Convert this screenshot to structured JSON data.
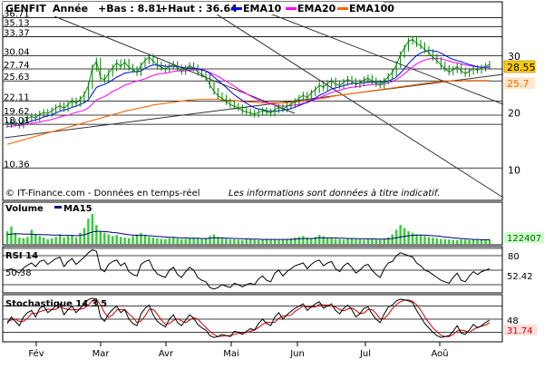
{
  "header": {
    "symbol": "GENFIT",
    "period": "Année",
    "low_label": "+Bas : 8.81",
    "high_label": "+Haut : 36.64",
    "legend": [
      {
        "label": "EMA10",
        "color": "#0000ff"
      },
      {
        "label": "EMA20",
        "color": "#ff00ff"
      },
      {
        "label": "EMA100",
        "color": "#ff6600"
      }
    ]
  },
  "footer": {
    "copyright": "© IT-Finance.com - Données en temps-réel",
    "disclaimer": "Les informations sont données à titre indicatif."
  },
  "colors": {
    "price": "#008000",
    "ema10": "#0000ff",
    "ema20": "#ff00ff",
    "ema100": "#ff6600",
    "volume": "#33cc33",
    "ma15": "#000080",
    "trend": "#333333",
    "last_price_bg": "#ffcc00",
    "last_ema_bg": "#ffe8cc"
  },
  "chart_data": [
    {
      "type": "line",
      "name": "price",
      "months": [
        "Fév",
        "Mar",
        "Avr",
        "Mai",
        "Jun",
        "Jul",
        "Aoû"
      ],
      "left_ticks": [
        "36.71",
        "35.13",
        "33.37",
        "30.04",
        "27.74",
        "25.63",
        "22.11",
        "19.62",
        "18.01",
        "10.36"
      ],
      "right_ticks": [
        "30",
        "20",
        "10"
      ],
      "last_price": "28.55",
      "last_ema": "25.7",
      "ylim": [
        8.81,
        36.64
      ],
      "close": [
        18.0,
        18.4,
        18.2,
        17.9,
        18.5,
        19.0,
        19.4,
        19.1,
        19.8,
        20.1,
        19.9,
        20.4,
        20.9,
        21.3,
        20.8,
        21.5,
        22.1,
        21.7,
        22.4,
        23.2,
        24.8,
        27.9,
        29.1,
        26.2,
        25.8,
        27.0,
        27.9,
        28.8,
        28.2,
        28.9,
        28.0,
        27.6,
        27.1,
        28.3,
        29.2,
        29.8,
        29.1,
        28.4,
        28.0,
        27.7,
        28.2,
        28.5,
        27.9,
        27.3,
        27.8,
        28.3,
        27.9,
        27.2,
        26.8,
        26.2,
        24.9,
        23.8,
        23.0,
        22.6,
        22.0,
        21.5,
        21.2,
        20.9,
        20.4,
        20.2,
        20.0,
        19.8,
        20.1,
        20.4,
        20.2,
        20.0,
        20.6,
        21.0,
        20.7,
        21.2,
        21.5,
        22.0,
        22.6,
        23.1,
        22.7,
        23.5,
        24.1,
        24.9,
        24.5,
        25.2,
        25.6,
        25.1,
        24.8,
        25.4,
        25.9,
        25.5,
        25.0,
        25.3,
        25.8,
        26.1,
        25.6,
        25.2,
        24.9,
        25.6,
        26.4,
        27.1,
        28.5,
        30.2,
        31.4,
        32.6,
        32.9,
        32.2,
        31.8,
        31.1,
        30.6,
        29.8,
        29.2,
        28.4,
        27.8,
        27.2,
        27.6,
        28.1,
        27.4,
        26.9,
        27.3,
        27.8,
        27.5,
        27.9,
        28.2,
        28.55
      ],
      "ema10": [
        18.0,
        18.1,
        18.1,
        18.1,
        18.2,
        18.3,
        18.6,
        18.8,
        19.0,
        19.3,
        19.5,
        19.7,
        20.0,
        20.3,
        20.5,
        20.7,
        21.0,
        21.2,
        21.5,
        21.8,
        22.3,
        23.4,
        24.5,
        24.8,
        25.0,
        25.4,
        25.8,
        26.3,
        26.6,
        27.0,
        27.1,
        27.3,
        27.2,
        27.4,
        27.8,
        28.2,
        28.4,
        28.4,
        28.3,
        28.2,
        28.2,
        28.2,
        28.1,
        28.0,
        27.9,
        27.9,
        27.9,
        27.8,
        27.6,
        27.4,
        26.9,
        26.3,
        25.7,
        25.1,
        24.5,
        23.8,
        23.2,
        22.7,
        22.2,
        21.7,
        21.3,
        20.9,
        20.7,
        20.6,
        20.4,
        20.3,
        20.3,
        20.4,
        20.5,
        20.6,
        20.8,
        21.0,
        21.3,
        21.6,
        21.9,
        22.2,
        22.6,
        23.1,
        23.4,
        23.8,
        24.2,
        24.4,
        24.6,
        24.8,
        25.0,
        25.2,
        25.2,
        25.2,
        25.3,
        25.4,
        25.4,
        25.4,
        25.4,
        25.4,
        25.6,
        25.9,
        26.3,
        27.0,
        27.8,
        28.7,
        29.4,
        30.1,
        30.5,
        30.8,
        31.0,
        30.9,
        30.8,
        30.5,
        30.1,
        29.7,
        29.4,
        29.2,
        29.0,
        28.7,
        28.5,
        28.3,
        28.1,
        28.0,
        28.0,
        28.1
      ],
      "ema20": [
        17.6,
        17.7,
        17.8,
        17.8,
        17.9,
        18.0,
        18.2,
        18.3,
        18.4,
        18.6,
        18.7,
        18.9,
        19.1,
        19.3,
        19.5,
        19.6,
        19.9,
        20.1,
        20.3,
        20.5,
        20.9,
        21.6,
        22.3,
        22.6,
        22.9,
        23.3,
        23.8,
        24.1,
        24.5,
        24.9,
        25.1,
        25.4,
        25.6,
        25.8,
        26.0,
        26.3,
        26.6,
        26.8,
        26.9,
        27.0,
        27.1,
        27.3,
        27.4,
        27.4,
        27.4,
        27.5,
        27.6,
        27.6,
        27.5,
        27.4,
        27.1,
        26.8,
        26.4,
        26.0,
        25.6,
        25.1,
        24.7,
        24.2,
        23.8,
        23.4,
        23.0,
        22.6,
        22.3,
        22.0,
        21.8,
        21.6,
        21.4,
        21.3,
        21.2,
        21.2,
        21.3,
        21.4,
        21.5,
        21.7,
        21.8,
        22.1,
        22.4,
        22.7,
        23.0,
        23.3,
        23.6,
        23.8,
        24.0,
        24.2,
        24.4,
        24.5,
        24.6,
        24.7,
        24.8,
        24.9,
        25.0,
        25.0,
        25.0,
        25.1,
        25.3,
        25.5,
        25.9,
        26.3,
        26.9,
        27.5,
        28.1,
        28.6,
        29.0,
        29.3,
        29.5,
        29.6,
        29.6,
        29.5,
        29.3,
        29.1,
        28.9,
        28.8,
        28.6,
        28.4,
        28.3,
        28.2,
        28.1,
        28.0,
        28.0,
        28.0
      ],
      "ema100": [
        14.5,
        14.7,
        14.9,
        15.1,
        15.3,
        15.5,
        15.7,
        15.9,
        16.1,
        16.3,
        16.5,
        16.7,
        16.9,
        17.1,
        17.3,
        17.5,
        17.7,
        17.9,
        18.1,
        18.3,
        18.5,
        18.7,
        18.9,
        19.1,
        19.3,
        19.5,
        19.7,
        19.9,
        20.1,
        20.3,
        20.5,
        20.6,
        20.8,
        20.9,
        21.1,
        21.2,
        21.4,
        21.5,
        21.6,
        21.7,
        21.8,
        21.9,
        22.0,
        22.1,
        22.2,
        22.3,
        22.3,
        22.4,
        22.4,
        22.4,
        22.4,
        22.4,
        22.4,
        22.3,
        22.3,
        22.2,
        22.2,
        22.1,
        22.0,
        22.0,
        21.9,
        21.9,
        21.8,
        21.8,
        21.8,
        21.8,
        21.8,
        21.8,
        21.8,
        21.8,
        21.9,
        21.9,
        22.0,
        22.1,
        22.2,
        22.3,
        22.4,
        22.5,
        22.6,
        22.7,
        22.9,
        23.0,
        23.1,
        23.2,
        23.3,
        23.4,
        23.5,
        23.6,
        23.7,
        23.8,
        23.9,
        24.0,
        24.1,
        24.2,
        24.3,
        24.4,
        24.5,
        24.6,
        24.7,
        24.8,
        24.9,
        25.0,
        25.1,
        25.2,
        25.3,
        25.4,
        25.4,
        25.5,
        25.5,
        25.6,
        25.6,
        25.6,
        25.6,
        25.7,
        25.7,
        25.7,
        25.7,
        25.7,
        25.7,
        25.7
      ]
    },
    {
      "type": "bar",
      "name": "volume",
      "title": "Volume",
      "legend": "MA15",
      "last_value": "122407",
      "values": [
        40,
        55,
        35,
        20,
        18,
        22,
        45,
        30,
        25,
        20,
        15,
        18,
        22,
        30,
        20,
        25,
        28,
        20,
        35,
        50,
        80,
        95,
        60,
        40,
        35,
        30,
        25,
        28,
        22,
        20,
        18,
        25,
        30,
        35,
        28,
        22,
        20,
        18,
        16,
        15,
        18,
        20,
        17,
        15,
        16,
        18,
        20,
        17,
        15,
        18,
        25,
        30,
        22,
        18,
        16,
        15,
        14,
        13,
        12,
        14,
        15,
        13,
        12,
        14,
        16,
        15,
        13,
        12,
        14,
        15,
        18,
        20,
        22,
        25,
        20,
        18,
        22,
        28,
        24,
        20,
        18,
        16,
        15,
        14,
        16,
        18,
        15,
        14,
        13,
        15,
        16,
        14,
        13,
        15,
        20,
        30,
        45,
        60,
        50,
        40,
        35,
        30,
        28,
        25,
        22,
        20,
        18,
        16,
        15,
        14,
        13,
        12,
        14,
        13,
        12,
        13,
        14,
        13,
        12,
        14
      ],
      "ma15": [
        30,
        31,
        32,
        32,
        31,
        31,
        31,
        30,
        30,
        29,
        29,
        28,
        28,
        28,
        27,
        27,
        27,
        26,
        27,
        29,
        33,
        38,
        40,
        40,
        39,
        38,
        36,
        35,
        33,
        31,
        29,
        28,
        27,
        27,
        27,
        26,
        25,
        24,
        23,
        22,
        21,
        21,
        20,
        19,
        19,
        18,
        18,
        18,
        17,
        17,
        18,
        19,
        19,
        19,
        18,
        18,
        17,
        17,
        16,
        16,
        15,
        15,
        15,
        14,
        14,
        14,
        14,
        14,
        14,
        14,
        14,
        15,
        16,
        17,
        17,
        17,
        18,
        19,
        19,
        19,
        19,
        19,
        18,
        18,
        17,
        17,
        17,
        16,
        16,
        16,
        16,
        15,
        15,
        15,
        16,
        17,
        19,
        22,
        24,
        26,
        27,
        28,
        28,
        28,
        27,
        26,
        25,
        24,
        22,
        21,
        19,
        18,
        17,
        16,
        15,
        14,
        14,
        13,
        13,
        13
      ]
    },
    {
      "type": "line",
      "name": "rsi",
      "title": "RSI 14",
      "left_label": "50.38",
      "last_value": "52.42",
      "ylim": [
        20,
        80
      ],
      "values": [
        50,
        52,
        49,
        46,
        53,
        57,
        60,
        55,
        62,
        64,
        58,
        62,
        66,
        68,
        55,
        62,
        66,
        58,
        63,
        68,
        74,
        78,
        76,
        52,
        48,
        58,
        62,
        64,
        56,
        60,
        48,
        44,
        42,
        58,
        62,
        64,
        52,
        45,
        42,
        40,
        50,
        54,
        44,
        40,
        48,
        54,
        50,
        40,
        36,
        34,
        26,
        24,
        26,
        30,
        28,
        26,
        32,
        30,
        27,
        30,
        32,
        30,
        38,
        42,
        36,
        34,
        46,
        50,
        42,
        48,
        52,
        56,
        58,
        60,
        52,
        58,
        62,
        64,
        56,
        60,
        62,
        52,
        48,
        56,
        60,
        54,
        46,
        50,
        56,
        58,
        50,
        44,
        40,
        52,
        60,
        62,
        70,
        74,
        72,
        70,
        68,
        60,
        56,
        50,
        48,
        44,
        40,
        36,
        34,
        32,
        40,
        46,
        36,
        34,
        42,
        48,
        44,
        48,
        50,
        52
      ]
    },
    {
      "type": "line",
      "name": "stochastic",
      "title": "Stochastique 14 3 5",
      "last_k": "48",
      "last_d": "31.74",
      "ylim": [
        0,
        100
      ],
      "k": [
        40,
        55,
        45,
        35,
        55,
        65,
        70,
        55,
        75,
        80,
        65,
        72,
        80,
        85,
        60,
        72,
        80,
        65,
        75,
        85,
        95,
        98,
        96,
        55,
        45,
        62,
        72,
        80,
        65,
        72,
        50,
        40,
        35,
        62,
        75,
        82,
        60,
        45,
        38,
        32,
        50,
        60,
        42,
        35,
        48,
        60,
        52,
        38,
        30,
        25,
        12,
        8,
        10,
        15,
        12,
        10,
        22,
        20,
        15,
        22,
        28,
        25,
        40,
        50,
        40,
        35,
        55,
        65,
        50,
        60,
        68,
        75,
        80,
        85,
        70,
        78,
        85,
        90,
        75,
        80,
        85,
        70,
        62,
        75,
        82,
        72,
        55,
        62,
        75,
        78,
        62,
        50,
        42,
        62,
        78,
        82,
        92,
        96,
        94,
        92,
        88,
        70,
        55,
        40,
        30,
        20,
        12,
        8,
        10,
        12,
        22,
        35,
        18,
        15,
        25,
        38,
        30,
        35,
        42,
        48
      ],
      "d": [
        45,
        48,
        50,
        45,
        45,
        52,
        63,
        63,
        67,
        70,
        73,
        72,
        72,
        79,
        75,
        72,
        71,
        72,
        73,
        75,
        82,
        93,
        96,
        83,
        65,
        54,
        60,
        71,
        72,
        72,
        62,
        54,
        42,
        46,
        57,
        73,
        72,
        62,
        48,
        38,
        40,
        47,
        51,
        46,
        42,
        48,
        53,
        50,
        40,
        31,
        22,
        15,
        10,
        11,
        12,
        12,
        15,
        17,
        19,
        19,
        22,
        25,
        31,
        38,
        43,
        42,
        43,
        52,
        57,
        58,
        59,
        68,
        74,
        80,
        78,
        78,
        78,
        84,
        83,
        82,
        80,
        78,
        72,
        69,
        73,
        76,
        70,
        63,
        64,
        72,
        72,
        63,
        51,
        51,
        61,
        74,
        84,
        90,
        94,
        94,
        91,
        83,
        71,
        55,
        42,
        30,
        21,
        13,
        10,
        10,
        15,
        23,
        25,
        23,
        19,
        26,
        31,
        34,
        36,
        42
      ]
    }
  ]
}
